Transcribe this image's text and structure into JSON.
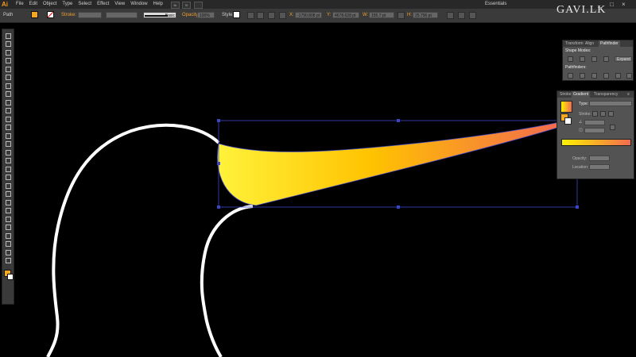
{
  "app": {
    "logo": "Ai"
  },
  "menu": [
    "File",
    "Edit",
    "Object",
    "Type",
    "Select",
    "Effect",
    "View",
    "Window",
    "Help"
  ],
  "menu_buttons": [
    "Br",
    "St"
  ],
  "workspace": "Essentials",
  "window_controls": [
    "_",
    "□",
    "×"
  ],
  "watermark": "GAVI.LK",
  "control_bar": {
    "selection_label": "Path",
    "stroke_label": "Stroke:",
    "profile_label": "Basic",
    "opacity_label": "Opacity:",
    "opacity_value": "100%",
    "style_label": "Style:",
    "x_label": "X:",
    "x_value": "-1790.808 pt",
    "y_label": "Y:",
    "y_value": "4678.628 pt",
    "w_label": "W:",
    "w_value": "155.7 pt",
    "h_label": "H:",
    "h_value": "25.796 pt",
    "fill_color": "#f5a623",
    "accent_color": "#f0a030"
  },
  "tools": [
    "selection-tool-icon",
    "direct-selection-tool-icon",
    "magic-wand-tool-icon",
    "lasso-tool-icon",
    "pen-tool-icon",
    "type-tool-icon",
    "line-tool-icon",
    "rectangle-tool-icon",
    "paintbrush-tool-icon",
    "pencil-tool-icon",
    "blob-brush-tool-icon",
    "eraser-tool-icon",
    "rotate-tool-icon",
    "scale-tool-icon",
    "width-tool-icon",
    "free-transform-tool-icon",
    "shape-builder-tool-icon",
    "perspective-grid-tool-icon",
    "mesh-tool-icon",
    "gradient-tool-icon",
    "eyedropper-tool-icon",
    "blend-tool-icon",
    "symbol-sprayer-tool-icon",
    "column-graph-tool-icon",
    "artboard-tool-icon",
    "slice-tool-icon",
    "hand-tool-icon",
    "zoom-tool-icon"
  ],
  "artwork": {
    "gradient_start": "#fff23a",
    "gradient_mid": "#ffc200",
    "gradient_end": "#f26a4f",
    "outline_color": "#ffffff",
    "bbox_color": "#3b46c4"
  },
  "pathfinder_panel": {
    "tabs": [
      "Transform",
      "Align",
      "Pathfinder"
    ],
    "active_tab": "Pathfinder",
    "shape_modes_label": "Shape Modes:",
    "expand_label": "Expand",
    "pathfinders_label": "Pathfinders:"
  },
  "gradient_panel": {
    "tabs": [
      "Stroke",
      "Gradient",
      "Transparency"
    ],
    "active_tab": "Gradient",
    "type_label": "Type:",
    "stroke_label": "Stroke:",
    "opacity_label": "Opacity:",
    "location_label": "Location:",
    "gradient_start": "#fff200",
    "gradient_end": "#f26a4f"
  }
}
